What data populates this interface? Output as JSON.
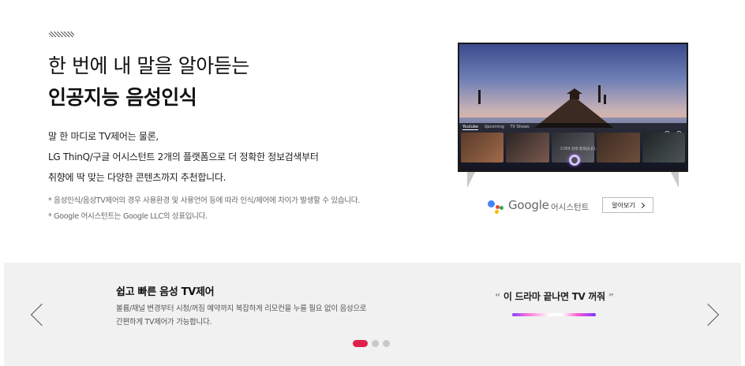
{
  "hero": {
    "title_line1": "한 번에 내 말을 알아듣는",
    "title_line2": "인공지능 음성인식",
    "body_line1": "말 한 마디로 TV제어는 물론,",
    "body_line2": "LG ThinQ/구글 어시스턴트 2개의 플랫폼으로 더 정확한 정보검색부터",
    "body_line3": "취향에 딱 맞는 다양한 콘텐츠까지 추천합니다.",
    "note1": "* 음성인식/음성TV제어의 경우 사용환경 및 사용언어 등에 따라 인식/제어에 차이가 발생할 수 있습니다.",
    "note2": "* Google 어시스턴트는 Google LLC의 상표입니다."
  },
  "tv_screen": {
    "tabs": [
      "Youtube",
      "Upcoming",
      "TV Shows"
    ],
    "assistant_prompt": "드라마 검색 결과입니다."
  },
  "google": {
    "brand": "Google",
    "assistant_label": "어시스턴트",
    "more_button": "알아보기"
  },
  "carousel": {
    "slide_title": "쉽고 빠른 음성 TV제어",
    "slide_desc_line1": "볼륨/채널 변경부터 시청/꺼짐 예약까지 복잡하게 리모컨을 누를 필요 없이 음성으로",
    "slide_desc_line2": "간편하게 TV제어가 가능합니다.",
    "quote_open": "“",
    "quote_text": "이 드라마 끝나면 TV 꺼줘",
    "quote_close": "”",
    "page_count": 3,
    "active_page": 1
  },
  "colors": {
    "accent": "#e0204b",
    "carousel_bg": "#f1f1f1"
  }
}
